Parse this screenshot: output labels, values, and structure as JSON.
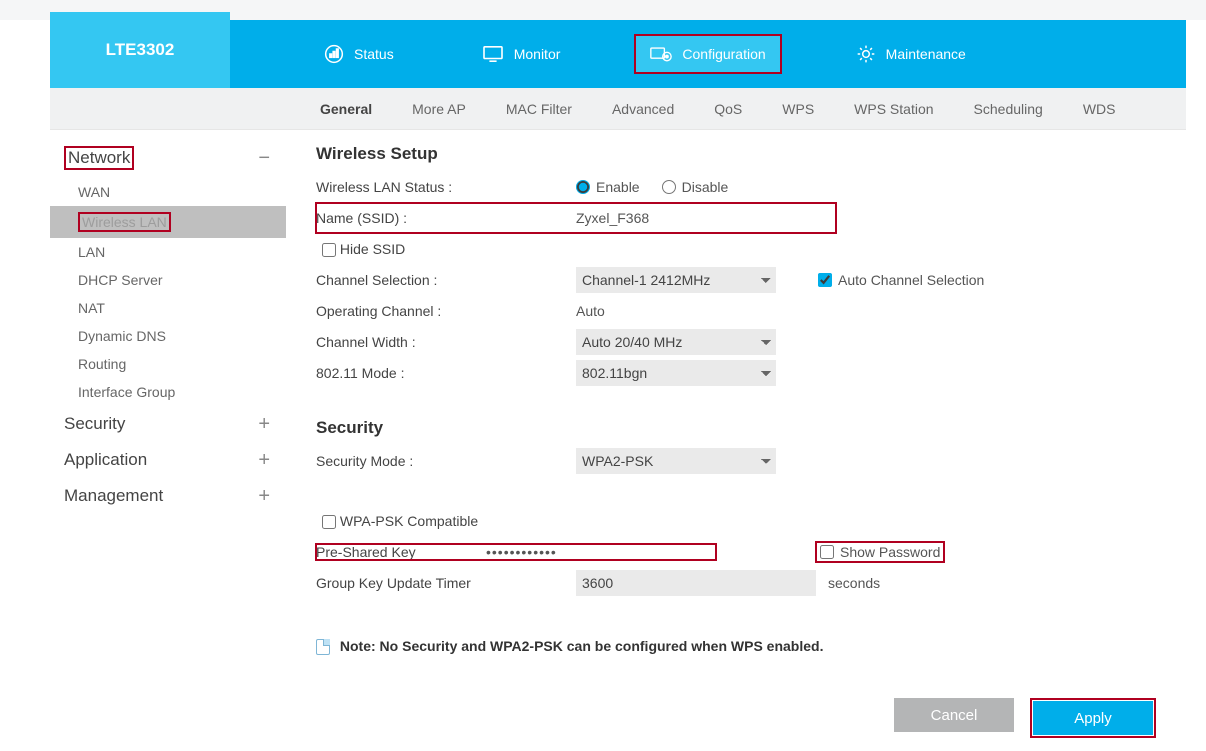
{
  "brand": "LTE3302",
  "topnav": {
    "status": "Status",
    "monitor": "Monitor",
    "configuration": "Configuration",
    "maintenance": "Maintenance"
  },
  "subtabs": {
    "general": "General",
    "moreap": "More AP",
    "macfilter": "MAC Filter",
    "advanced": "Advanced",
    "qos": "QoS",
    "wps": "WPS",
    "wpsstation": "WPS Station",
    "scheduling": "Scheduling",
    "wds": "WDS"
  },
  "sidebar": {
    "network": "Network",
    "wan": "WAN",
    "wirelesslan": "Wireless LAN",
    "lan": "LAN",
    "dhcp": "DHCP Server",
    "nat": "NAT",
    "ddns": "Dynamic DNS",
    "routing": "Routing",
    "ifgroup": "Interface Group",
    "security": "Security",
    "application": "Application",
    "management": "Management"
  },
  "wireless": {
    "heading": "Wireless Setup",
    "status_label": "Wireless LAN Status :",
    "enable": "Enable",
    "disable": "Disable",
    "ssid_label": "Name (SSID) :",
    "ssid_value": "Zyxel_F368",
    "hide_ssid": "Hide SSID",
    "channel_sel_label": "Channel Selection :",
    "channel_sel_value": "Channel-1 2412MHz",
    "auto_channel": "Auto Channel Selection",
    "op_channel_label": "Operating Channel :",
    "op_channel_value": "Auto",
    "ch_width_label": "Channel Width :",
    "ch_width_value": "Auto 20/40 MHz",
    "mode_label": "802.11 Mode :",
    "mode_value": "802.11bgn"
  },
  "security": {
    "heading": "Security",
    "mode_label": "Security Mode :",
    "mode_value": "WPA2-PSK",
    "wpa_compat": "WPA-PSK Compatible",
    "psk_label": "Pre-Shared Key",
    "psk_value": "••••••••••••",
    "show_pw": "Show Password",
    "gkt_label": "Group Key Update Timer",
    "gkt_value": "3600",
    "gkt_unit": "seconds"
  },
  "note": "Note: No Security and WPA2-PSK can be configured when WPS enabled.",
  "buttons": {
    "cancel": "Cancel",
    "apply": "Apply"
  }
}
